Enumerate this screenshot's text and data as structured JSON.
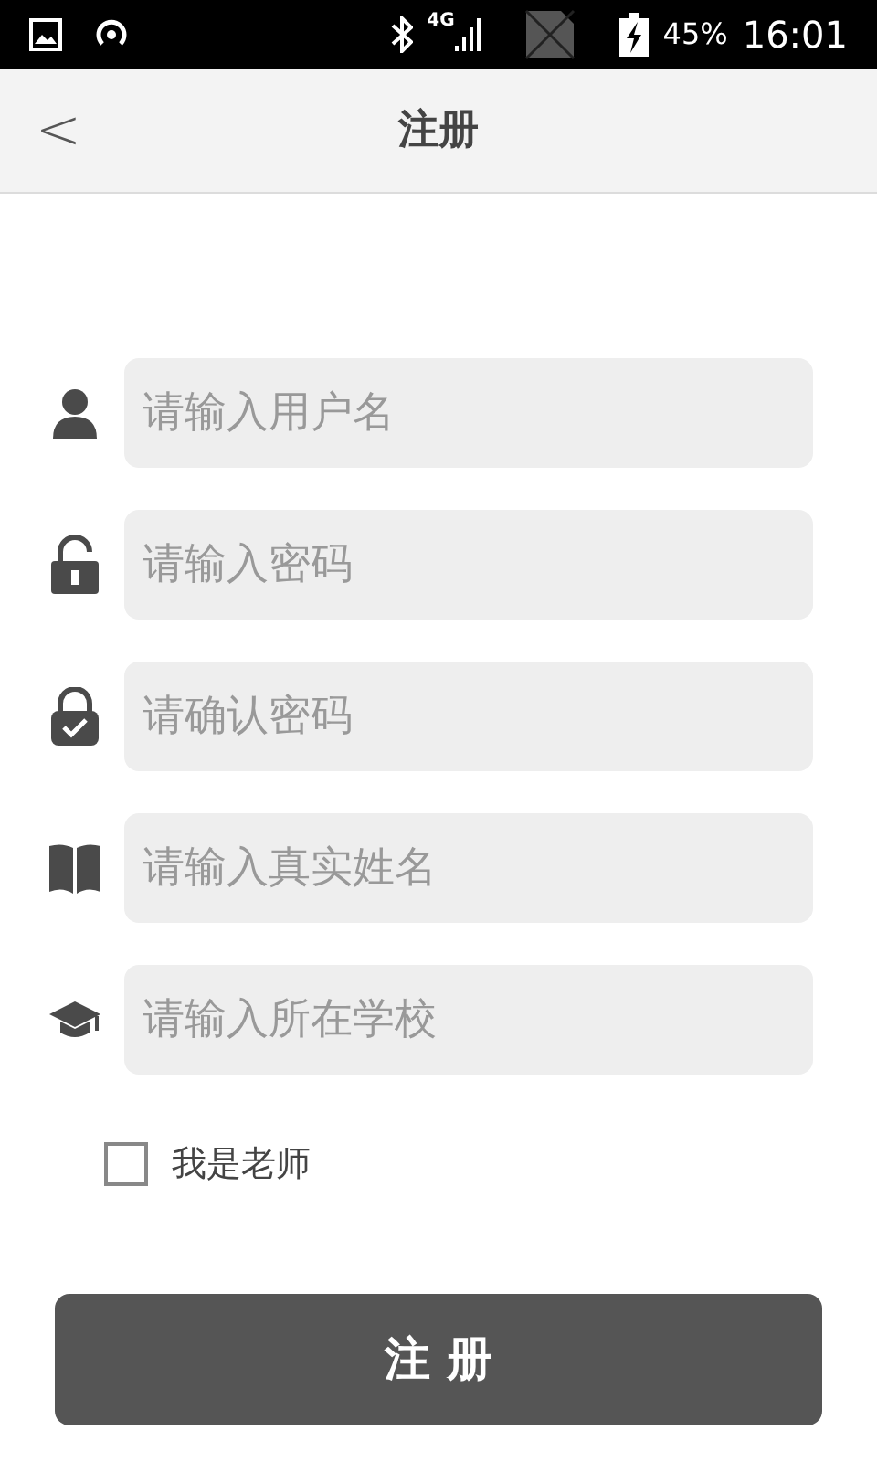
{
  "status_bar": {
    "network": "4G",
    "battery": "45%",
    "time": "16:01"
  },
  "header": {
    "back": "<",
    "title": "注册"
  },
  "fields": [
    {
      "kind": "user",
      "placeholder": "请输入用户名"
    },
    {
      "kind": "lock",
      "placeholder": "请输入密码"
    },
    {
      "kind": "lock-check",
      "placeholder": "请确认密码"
    },
    {
      "kind": "book",
      "placeholder": "请输入真实姓名"
    },
    {
      "kind": "school",
      "placeholder": "请输入所在学校"
    }
  ],
  "teacher_checkbox": {
    "label": "我是老师",
    "checked": false
  },
  "submit_button": "注 册"
}
